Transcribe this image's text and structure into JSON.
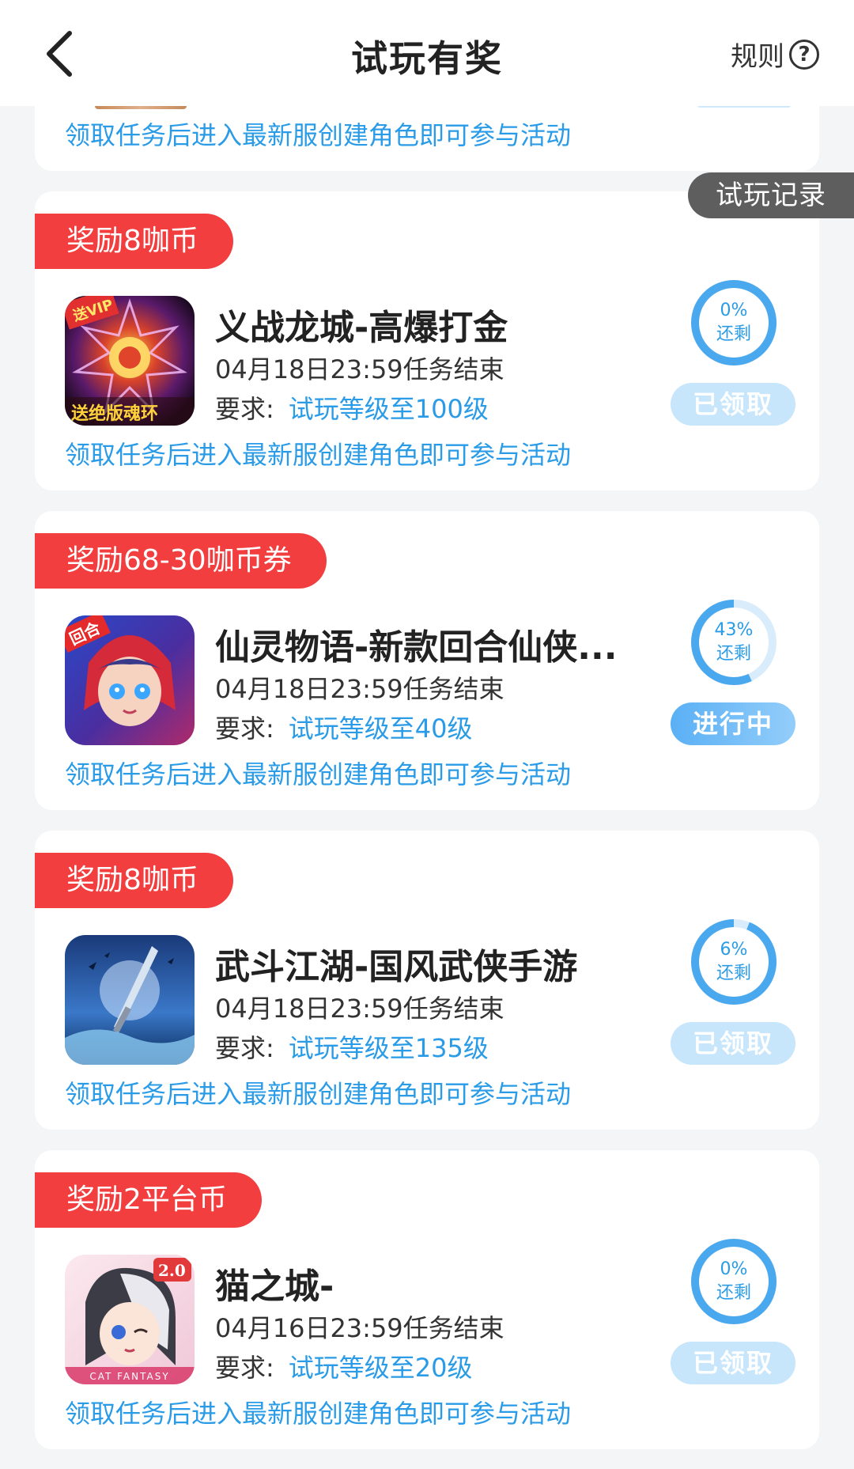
{
  "header": {
    "title": "试玩有奖",
    "rules_label": "规则",
    "help_symbol": "?"
  },
  "record_tab": "试玩记录",
  "partial_card": {
    "tip": "领取任务后进入最新服创建角色即可参与活动"
  },
  "cards": [
    {
      "reward": "奖励8咖币",
      "name": "义战龙城-高爆打金",
      "end_time": "04月18日23:59任务结束",
      "req_label": "要求:",
      "req_value": "试玩等级至100级",
      "tip": "领取任务后进入最新服创建角色即可参与活动",
      "progress_pct": "0%",
      "progress_value": 0,
      "remaining_label": "还剩",
      "status": "已领取",
      "icon_label": "送VIP",
      "icon_caption": "送绝版魂环"
    },
    {
      "reward": "奖励68-30咖币券",
      "name": "仙灵物语-新款回合仙侠...",
      "end_time": "04月18日23:59任务结束",
      "req_label": "要求:",
      "req_value": "试玩等级至40级",
      "tip": "领取任务后进入最新服创建角色即可参与活动",
      "progress_pct": "43%",
      "progress_value": 0.43,
      "remaining_label": "还剩",
      "status": "进行中",
      "icon_label": "回合"
    },
    {
      "reward": "奖励8咖币",
      "name": "武斗江湖-国风武侠手游",
      "end_time": "04月18日23:59任务结束",
      "req_label": "要求:",
      "req_value": "试玩等级至135级",
      "tip": "领取任务后进入最新服创建角色即可参与活动",
      "progress_pct": "6%",
      "progress_value": 0.06,
      "remaining_label": "还剩",
      "status": "已领取"
    },
    {
      "reward": "奖励2平台币",
      "name": "猫之城-",
      "end_time": "04月16日23:59任务结束",
      "req_label": "要求:",
      "req_value": "试玩等级至20级",
      "tip": "领取任务后进入最新服创建角色即可参与活动",
      "progress_pct": "0%",
      "progress_value": 0,
      "remaining_label": "还剩",
      "status": "已领取",
      "icon_label": "2.0",
      "icon_caption": "CAT FANTASY"
    }
  ],
  "colors": {
    "accent_blue": "#2a9be6",
    "reward_red": "#f23e3e",
    "claimed_button": "#c7e6fb",
    "record_tab": "#5e5e5e"
  }
}
